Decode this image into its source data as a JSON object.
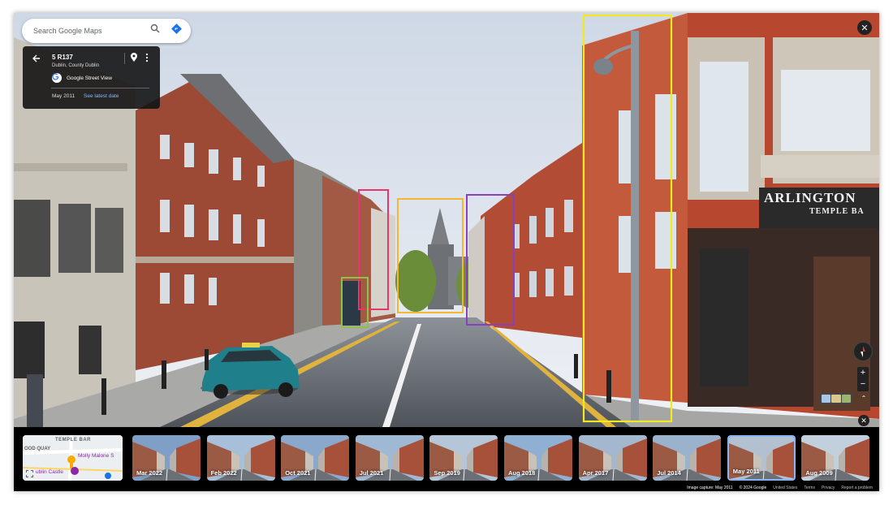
{
  "search": {
    "placeholder": "Search Google Maps"
  },
  "location_card": {
    "title": "5 R137",
    "subtitle": "Dublin, County Dublin",
    "provider": "Google Street View",
    "capture_date": "May 2011",
    "latest_link": "See latest date"
  },
  "signage": {
    "line1": "ARLINGTON",
    "line2": "TEMPLE BA"
  },
  "minimap": {
    "label1": "TEMPLE BAR",
    "label2": "OOD QUAY",
    "label3": "Molly Malone S",
    "label4": "ublin Castle"
  },
  "timeline": {
    "items": [
      {
        "label": "Mar 2022",
        "selected": false
      },
      {
        "label": "Feb 2022",
        "selected": false
      },
      {
        "label": "Oct 2021",
        "selected": false
      },
      {
        "label": "Jul 2021",
        "selected": false
      },
      {
        "label": "Sep 2019",
        "selected": false
      },
      {
        "label": "Aug 2018",
        "selected": false
      },
      {
        "label": "Apr 2017",
        "selected": false
      },
      {
        "label": "Jul 2014",
        "selected": false
      },
      {
        "label": "May 2011",
        "selected": true
      },
      {
        "label": "Aug 2009",
        "selected": false
      }
    ]
  },
  "footer": {
    "capture": "Image capture: May 2011",
    "copyright": "© 2024 Google",
    "region": "United States",
    "terms": "Terms",
    "privacy": "Privacy",
    "report": "Report a problem"
  },
  "annotation_colors": {
    "lamp_post": "#f2ea1e",
    "building_left": "#e8366c",
    "cathedral": "#f5b731",
    "building_right": "#8a3fbf",
    "phone_box": "#8bc34a"
  },
  "accent": "#8ab4f8"
}
